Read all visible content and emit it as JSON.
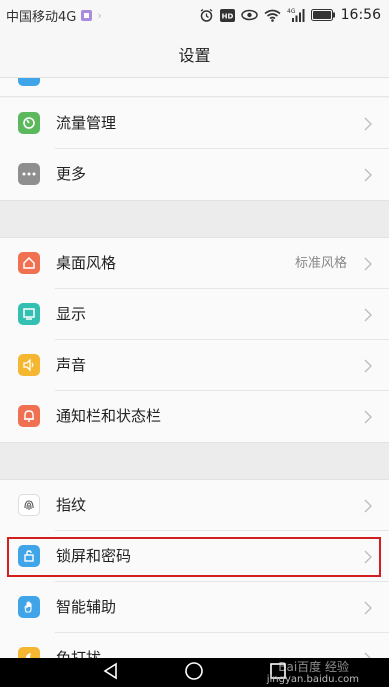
{
  "status_bar": {
    "carrier": "中国移动4G",
    "network_badge": "4G",
    "time": "16:56",
    "icons": [
      "sim-icon",
      "alarm-icon",
      "hd-icon",
      "eye-icon",
      "wifi-icon",
      "signal-icon",
      "battery-icon"
    ]
  },
  "title": "设置",
  "settings": {
    "items": [
      {
        "label": "流量管理",
        "icon": "data-usage-icon",
        "color": "#5cb85c"
      },
      {
        "label": "更多",
        "icon": "more-dots-icon",
        "color": "#8f8f8f"
      },
      {
        "label": "桌面风格",
        "value": "标准风格",
        "icon": "home-icon",
        "color": "#f07052"
      },
      {
        "label": "显示",
        "icon": "display-icon",
        "color": "#33bfb2"
      },
      {
        "label": "声音",
        "icon": "sound-icon",
        "color": "#f5b731"
      },
      {
        "label": "通知栏和状态栏",
        "icon": "notification-icon",
        "color": "#f07052"
      },
      {
        "label": "指纹",
        "icon": "fingerprint-icon",
        "color": "#ffffff"
      },
      {
        "label": "锁屏和密码",
        "icon": "lock-icon",
        "color": "#3fa5e8"
      },
      {
        "label": "智能辅助",
        "icon": "hand-icon",
        "color": "#3fa5e8"
      },
      {
        "label": "免打扰",
        "icon": "moon-icon",
        "color": "#f5b731"
      }
    ]
  },
  "watermark": {
    "logo_text": "Bai百度 经验",
    "url": "jingyan.baidu.com"
  }
}
